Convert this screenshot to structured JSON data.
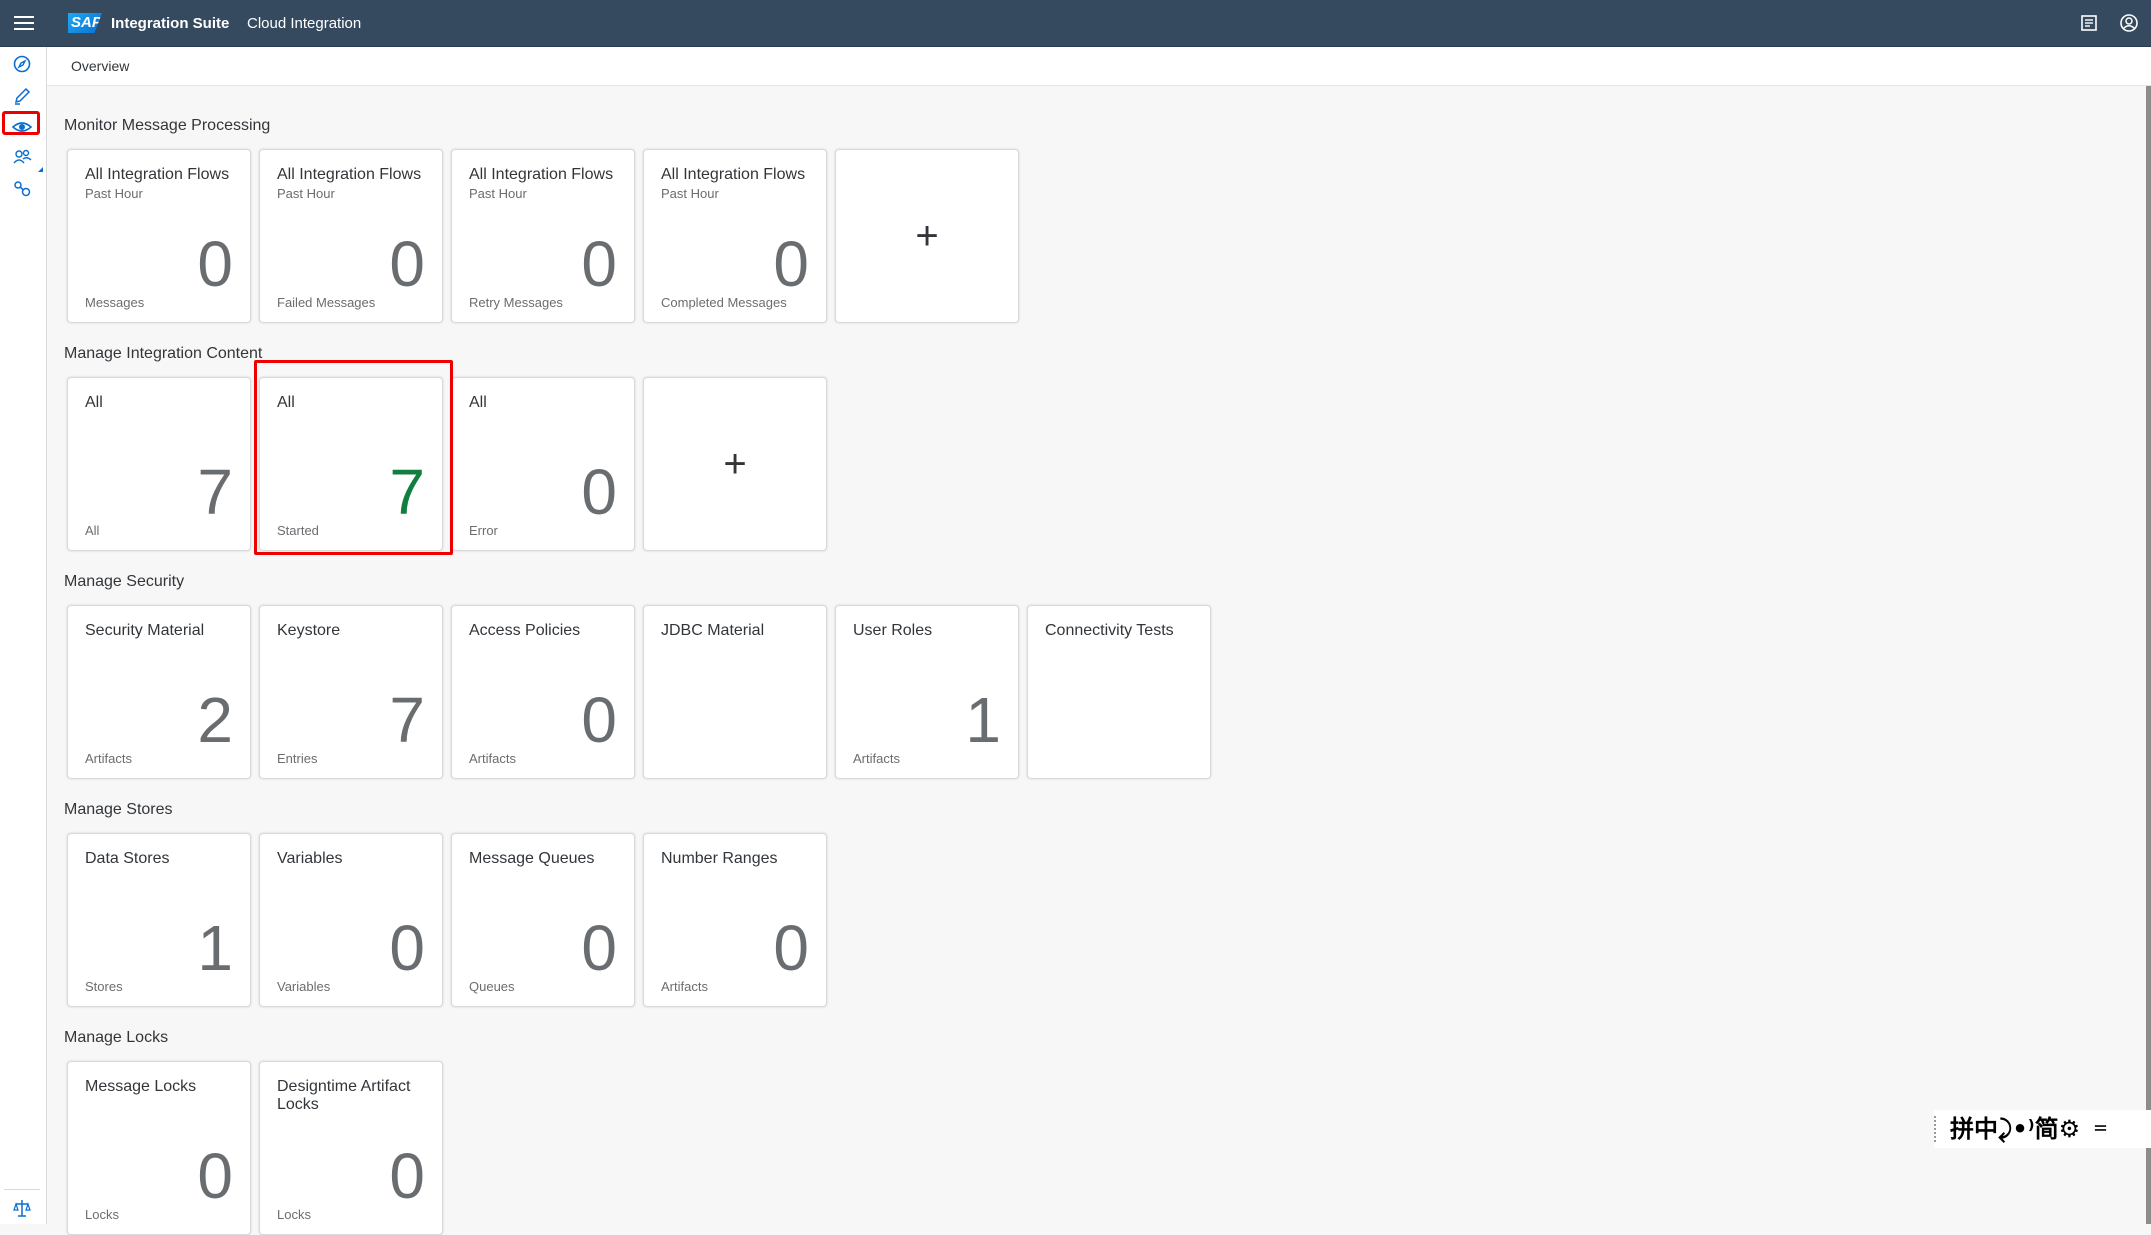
{
  "shell": {
    "logo_text": "SAP",
    "product": "Integration Suite",
    "app": "Cloud Integration",
    "icons": [
      "menu-icon",
      "notes-icon",
      "user-profile-icon"
    ]
  },
  "nav": {
    "icons": [
      "discover-icon",
      "design-icon",
      "monitor-icon",
      "user-groups-icon",
      "settings-icon",
      "legal-icon"
    ],
    "selected": "monitor-icon"
  },
  "breadcrumb": "Overview",
  "sections": {
    "monitor": {
      "title": "Monitor Message Processing",
      "tiles": [
        {
          "title": "All Integration Flows",
          "sub": "Past Hour",
          "value": "0",
          "foot": "Messages"
        },
        {
          "title": "All Integration Flows",
          "sub": "Past Hour",
          "value": "0",
          "foot": "Failed Messages"
        },
        {
          "title": "All Integration Flows",
          "sub": "Past Hour",
          "value": "0",
          "foot": "Retry Messages"
        },
        {
          "title": "All Integration Flows",
          "sub": "Past Hour",
          "value": "0",
          "foot": "Completed Messages"
        },
        {
          "plus": "+"
        }
      ]
    },
    "content": {
      "title": "Manage Integration Content",
      "tiles": [
        {
          "title": "All",
          "value": "7",
          "foot": "All"
        },
        {
          "title": "All",
          "value": "7",
          "foot": "Started",
          "value_color": "#107e3e"
        },
        {
          "title": "All",
          "value": "0",
          "foot": "Error"
        },
        {
          "plus": "+"
        }
      ]
    },
    "security": {
      "title": "Manage Security",
      "tiles": [
        {
          "title": "Security Material",
          "value": "2",
          "foot": "Artifacts"
        },
        {
          "title": "Keystore",
          "value": "7",
          "foot": "Entries"
        },
        {
          "title": "Access Policies",
          "value": "0",
          "foot": "Artifacts"
        },
        {
          "title": "JDBC Material"
        },
        {
          "title": "User Roles",
          "value": "1",
          "foot": "Artifacts"
        },
        {
          "title": "Connectivity Tests"
        }
      ]
    },
    "stores": {
      "title": "Manage Stores",
      "tiles": [
        {
          "title": "Data Stores",
          "value": "1",
          "foot": "Stores"
        },
        {
          "title": "Variables",
          "value": "0",
          "foot": "Variables"
        },
        {
          "title": "Message Queues",
          "value": "0",
          "foot": "Queues"
        },
        {
          "title": "Number Ranges",
          "value": "0",
          "foot": "Artifacts"
        }
      ]
    },
    "locks": {
      "title": "Manage Locks",
      "tiles": [
        {
          "title": "Message Locks",
          "value": "0",
          "foot": "Locks"
        },
        {
          "title": "Designtime Artifact Locks",
          "value": "0",
          "foot": "Locks"
        }
      ]
    }
  },
  "ime": {
    "text": "拼中⤸•⁾简⚙ ゠"
  },
  "colors": {
    "shell_bg": "#354a5f",
    "page_bg": "#f7f7f7",
    "accent": "#0a6ed1",
    "positive": "#107e3e",
    "highlight": "#ee0000"
  }
}
